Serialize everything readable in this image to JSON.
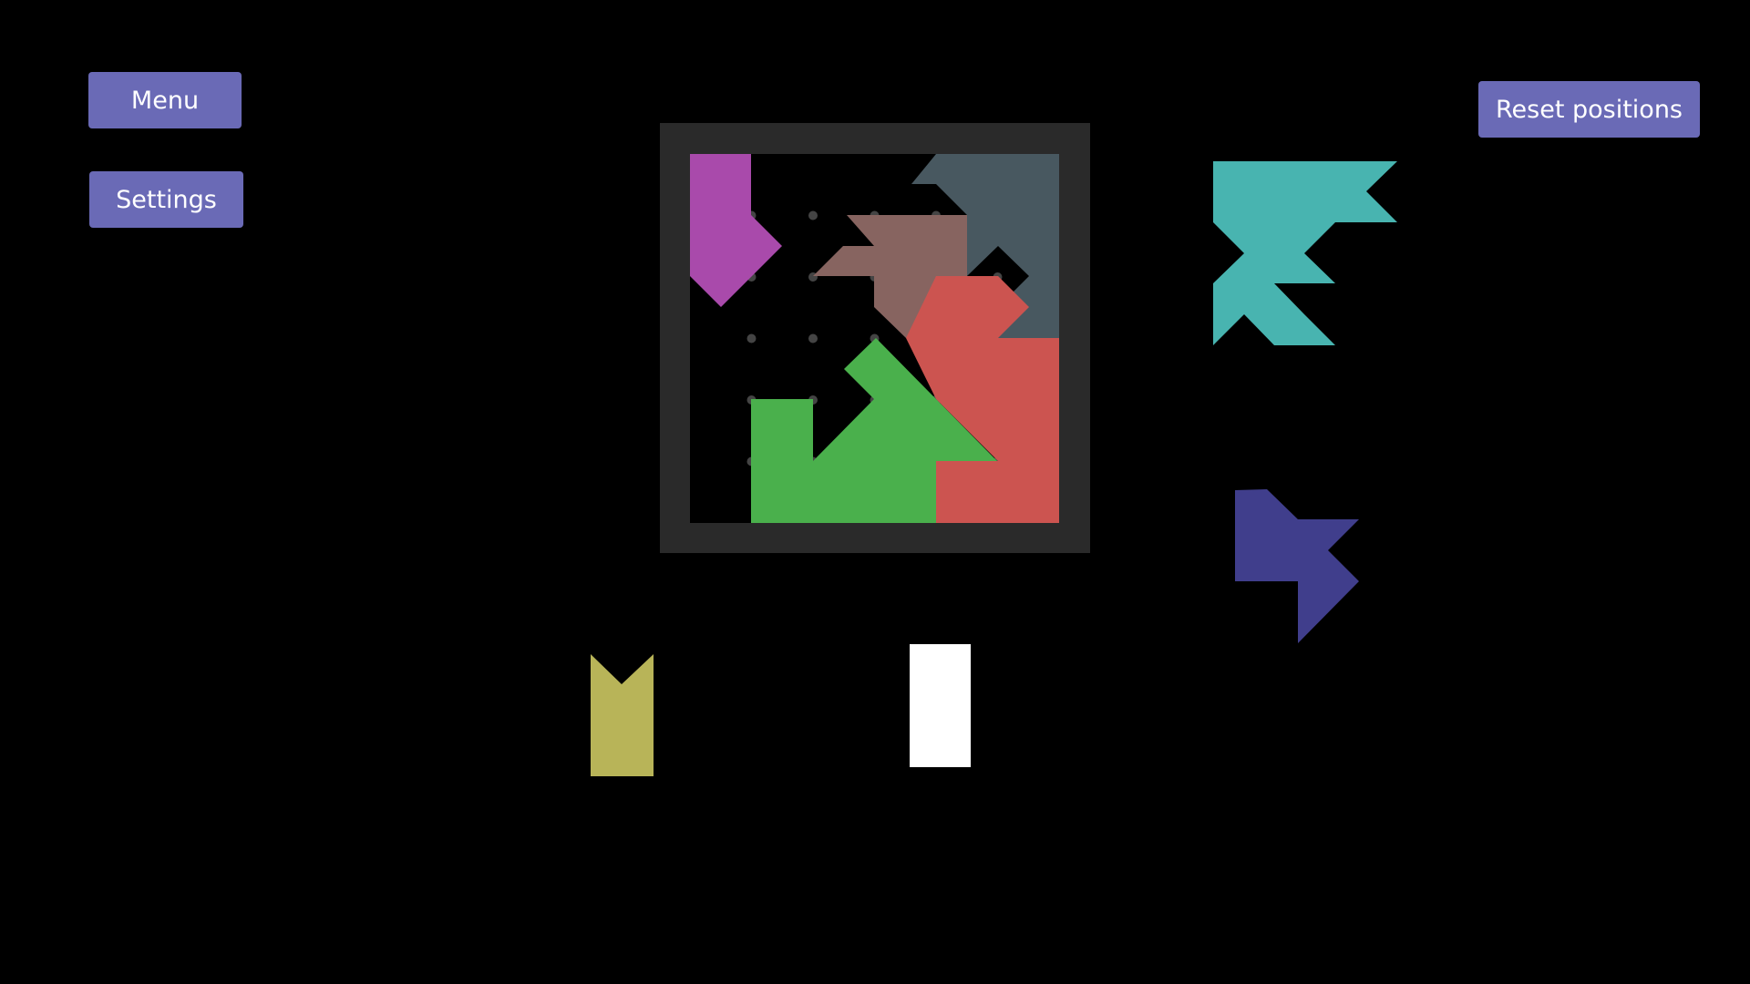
{
  "buttons": {
    "menu": "Menu",
    "settings": "Settings",
    "reset": "Reset positions"
  },
  "board": {
    "frame_color": "#2a2a2a",
    "background": "#000000",
    "grid_size": 6,
    "dot_color": "#444444"
  },
  "pieces": [
    {
      "name": "purple-piece",
      "color": "#a94aab",
      "on_board": true
    },
    {
      "name": "slate-piece",
      "color": "#485860",
      "on_board": true
    },
    {
      "name": "brown-piece",
      "color": "#876460",
      "on_board": true
    },
    {
      "name": "red-piece",
      "color": "#cc5450",
      "on_board": true
    },
    {
      "name": "green-piece",
      "color": "#4ab04c",
      "on_board": true
    },
    {
      "name": "teal-piece",
      "color": "#48b4b0",
      "on_board": false
    },
    {
      "name": "navy-piece",
      "color": "#403e8c",
      "on_board": false
    },
    {
      "name": "olive-piece",
      "color": "#b8b458",
      "on_board": false
    },
    {
      "name": "white-piece",
      "color": "#ffffff",
      "on_board": false
    }
  ]
}
